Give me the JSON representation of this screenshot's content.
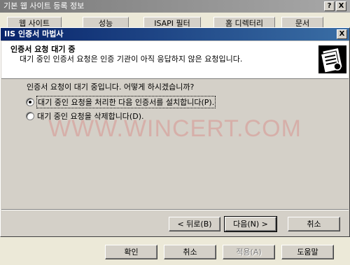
{
  "back_window": {
    "title": "기본 웹 사이트 등록 정보",
    "help_btn": "?",
    "close_btn": "X",
    "tabs": [
      "웹 사이트",
      "성능",
      "ISAPI 필터",
      "홈 디렉터리",
      "문서"
    ],
    "buttons": {
      "ok": "확인",
      "cancel": "취소",
      "apply": "적용(A)",
      "help": "도움말"
    }
  },
  "wizard": {
    "title": "IIS 인증서 마법사",
    "close_btn": "X",
    "header_title": "인증서 요청 대기 중",
    "header_subtitle": "대기 중인 인증서 요청은 인증 기관이 아직 응답하지 않은 요청입니다.",
    "question": "인증서 요청이 대기 중입니다. 어떻게 하시겠습니까?",
    "options": [
      {
        "label": "대기 중인 요청을 처리한 다음 인증서를 설치합니다(P).",
        "checked": true
      },
      {
        "label": "대기 중인 요청을 삭제합니다(D).",
        "checked": false
      }
    ],
    "buttons": {
      "back": "< 뒤로(B)",
      "next": "다음(N) >",
      "cancel": "취소"
    }
  },
  "watermark": "WWW.WINCERT.COM"
}
